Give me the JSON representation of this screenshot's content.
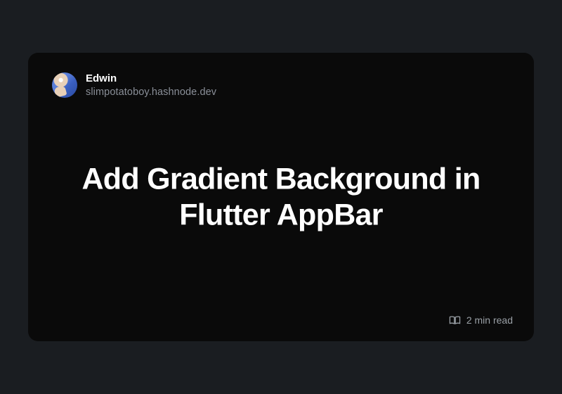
{
  "author": {
    "name": "Edwin",
    "domain": "slimpotatoboy.hashnode.dev"
  },
  "post": {
    "title": "Add Gradient Background in Flutter AppBar",
    "read_time": "2 min read"
  },
  "colors": {
    "page_bg": "#1a1d21",
    "card_bg": "#0a0a0a",
    "text_primary": "#ffffff",
    "text_muted": "#8a8f98"
  }
}
